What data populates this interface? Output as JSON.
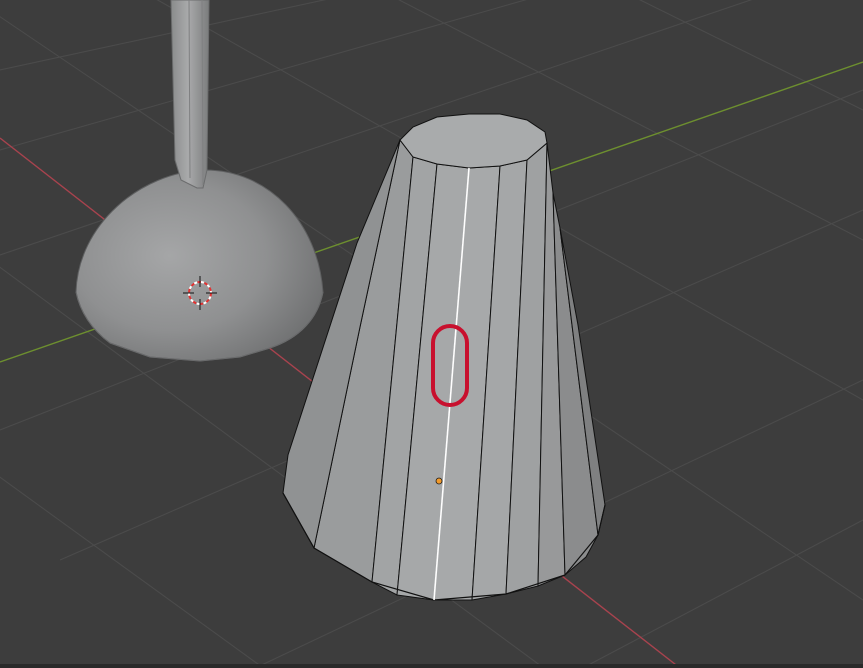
{
  "viewport": {
    "editor": "3D Viewport",
    "view": "perspective",
    "shading": "solid",
    "selection_mode": "face",
    "background_color": "#3d3d3d"
  },
  "colors": {
    "grid_line": "#4a4a4a",
    "x_axis": "#a8434e",
    "y_axis": "#6d8f2f",
    "mesh_face": "#a3a5a6",
    "mesh_edge": "#111111",
    "selected_edge": "#ffffff",
    "annotation": "#c8102e",
    "origin_point": "#f29a2b"
  },
  "objects": [
    {
      "name": "cone",
      "type": "mesh",
      "selected": true,
      "icon": "cone-mesh-icon"
    },
    {
      "name": "sphere-dome",
      "type": "mesh",
      "selected": false,
      "icon": "hemisphere-mesh-icon"
    },
    {
      "name": "handle",
      "type": "mesh",
      "selected": false,
      "icon": "cylinder-mesh-icon"
    }
  ],
  "overlays": {
    "cursor_icon": "3d-cursor-icon",
    "origin_icon": "object-origin-icon",
    "annotation_shape": "rounded-capsule"
  }
}
